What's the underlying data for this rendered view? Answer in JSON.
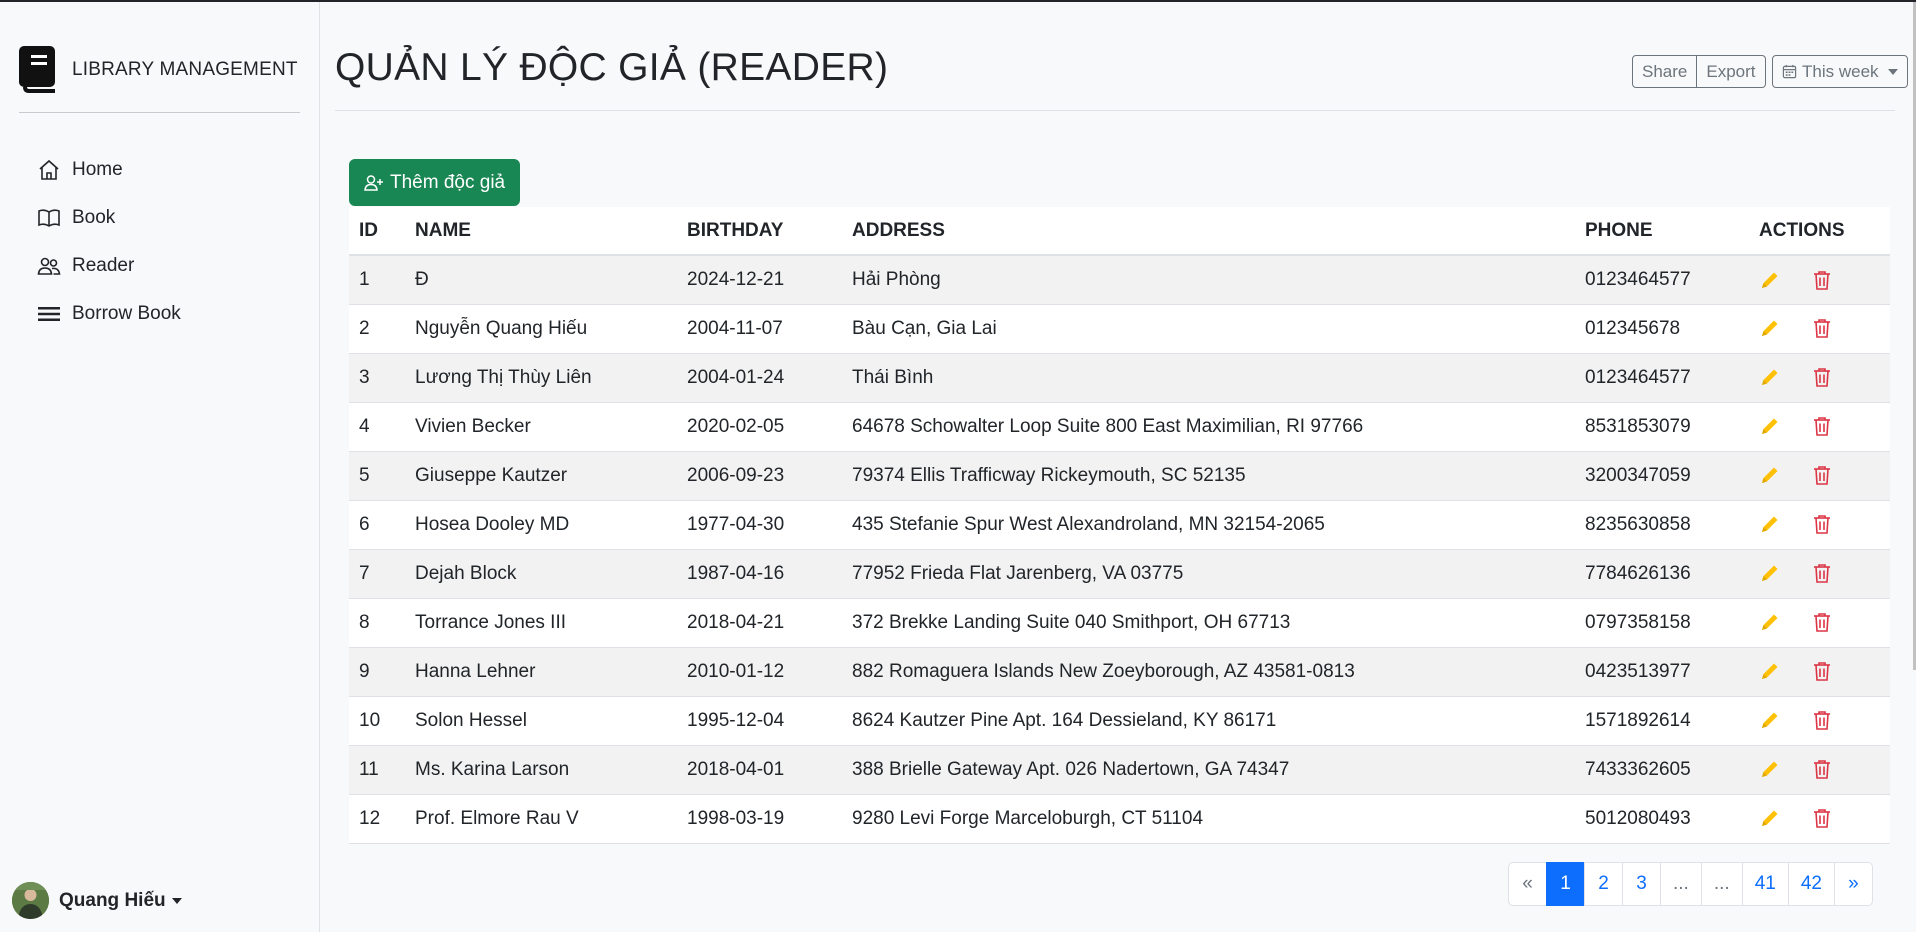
{
  "brand": {
    "title": "LIBRARY MANAGEMENT",
    "icon": "book-icon"
  },
  "nav": [
    {
      "label": "Home",
      "icon": "house-icon"
    },
    {
      "label": "Book",
      "icon": "book-open-icon"
    },
    {
      "label": "Reader",
      "icon": "people-icon"
    },
    {
      "label": "Borrow Book",
      "icon": "list-icon"
    }
  ],
  "user": {
    "name": "Quang Hiếu"
  },
  "header": {
    "title": "QUẢN LÝ ĐỘC GIẢ (READER)",
    "share_label": "Share",
    "export_label": "Export",
    "period_label": "This week"
  },
  "add_button": {
    "label": "Thêm độc giả"
  },
  "table": {
    "columns": [
      "ID",
      "NAME",
      "BIRTHDAY",
      "ADDRESS",
      "PHONE",
      "ACTIONS"
    ],
    "rows": [
      {
        "id": "1",
        "name": "Đ",
        "birthday": "2024-12-21",
        "address": "Hải Phòng",
        "phone": "0123464577"
      },
      {
        "id": "2",
        "name": "Nguyễn Quang Hiếu",
        "birthday": "2004-11-07",
        "address": "Bàu Cạn, Gia Lai",
        "phone": "012345678"
      },
      {
        "id": "3",
        "name": "Lương Thị Thùy Liên",
        "birthday": "2004-01-24",
        "address": "Thái Bình",
        "phone": "0123464577"
      },
      {
        "id": "4",
        "name": "Vivien Becker",
        "birthday": "2020-02-05",
        "address": "64678 Schowalter Loop Suite 800 East Maximilian, RI 97766",
        "phone": "8531853079"
      },
      {
        "id": "5",
        "name": "Giuseppe Kautzer",
        "birthday": "2006-09-23",
        "address": "79374 Ellis Trafficway Rickeymouth, SC 52135",
        "phone": "3200347059"
      },
      {
        "id": "6",
        "name": "Hosea Dooley MD",
        "birthday": "1977-04-30",
        "address": "435 Stefanie Spur West Alexandroland, MN 32154-2065",
        "phone": "8235630858"
      },
      {
        "id": "7",
        "name": "Dejah Block",
        "birthday": "1987-04-16",
        "address": "77952 Frieda Flat Jarenberg, VA 03775",
        "phone": "7784626136"
      },
      {
        "id": "8",
        "name": "Torrance Jones III",
        "birthday": "2018-04-21",
        "address": "372 Brekke Landing Suite 040 Smithport, OH 67713",
        "phone": "0797358158"
      },
      {
        "id": "9",
        "name": "Hanna Lehner",
        "birthday": "2010-01-12",
        "address": "882 Romaguera Islands New Zoeyborough, AZ 43581-0813",
        "phone": "0423513977"
      },
      {
        "id": "10",
        "name": "Solon Hessel",
        "birthday": "1995-12-04",
        "address": "8624 Kautzer Pine Apt. 164 Dessieland, KY 86171",
        "phone": "1571892614"
      },
      {
        "id": "11",
        "name": "Ms. Karina Larson",
        "birthday": "2018-04-01",
        "address": "388 Brielle Gateway Apt. 026 Nadertown, GA 74347",
        "phone": "7433362605"
      },
      {
        "id": "12",
        "name": "Prof. Elmore Rau V",
        "birthday": "1998-03-19",
        "address": "9280 Levi Forge Marceloburgh, CT 51104",
        "phone": "5012080493"
      }
    ],
    "edit_icon": "pencil-icon",
    "delete_icon": "trash-icon",
    "edit_color": "#ffc107",
    "delete_color": "#dc3545"
  },
  "pagination": {
    "prev": "«",
    "pages": [
      "1",
      "2",
      "3",
      "...",
      "...",
      "41",
      "42"
    ],
    "next": "»",
    "active": "1"
  },
  "colors": {
    "primary": "#0d6efd",
    "success": "#198754"
  }
}
